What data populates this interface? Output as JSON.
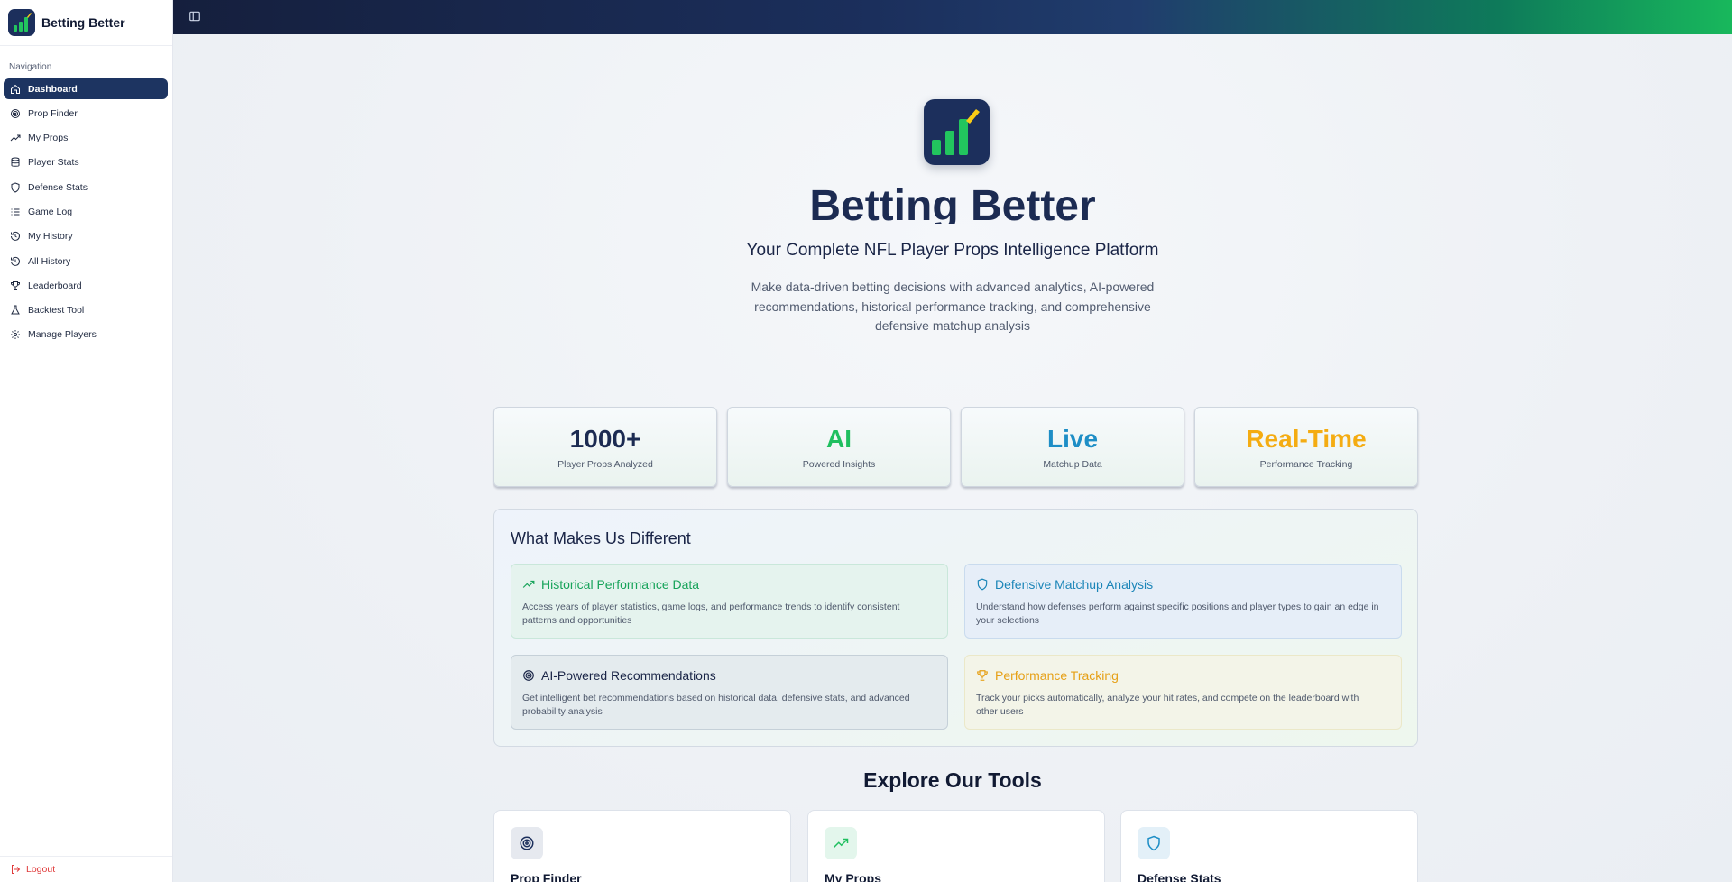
{
  "app": {
    "name": "Betting Better"
  },
  "sidebar": {
    "section_label": "Navigation",
    "items": [
      {
        "label": "Dashboard",
        "icon": "home-icon",
        "active": true
      },
      {
        "label": "Prop Finder",
        "icon": "target-icon"
      },
      {
        "label": "My Props",
        "icon": "trending-up-icon"
      },
      {
        "label": "Player Stats",
        "icon": "database-icon"
      },
      {
        "label": "Defense Stats",
        "icon": "shield-icon"
      },
      {
        "label": "Game Log",
        "icon": "list-icon"
      },
      {
        "label": "My History",
        "icon": "history-icon"
      },
      {
        "label": "All History",
        "icon": "history-icon"
      },
      {
        "label": "Leaderboard",
        "icon": "trophy-icon"
      },
      {
        "label": "Backtest Tool",
        "icon": "flask-icon"
      },
      {
        "label": "Manage Players",
        "icon": "gear-icon"
      }
    ],
    "logout_label": "Logout"
  },
  "hero": {
    "title": "Betting Better",
    "subtitle": "Your Complete NFL Player Props Intelligence Platform",
    "description": "Make data-driven betting decisions with advanced analytics, AI-powered recommendations, historical performance tracking, and comprehensive defensive matchup analysis"
  },
  "stats": [
    {
      "value": "1000+",
      "label": "Player Props Analyzed",
      "color": "#1c2b52"
    },
    {
      "value": "AI",
      "label": "Powered Insights",
      "color": "#1fbf5f"
    },
    {
      "value": "Live",
      "label": "Matchup Data",
      "color": "#1e8ec6"
    },
    {
      "value": "Real-Time",
      "label": "Performance Tracking",
      "color": "#f4ac12"
    }
  ],
  "different": {
    "title": "What Makes Us Different",
    "cards": [
      {
        "title": "Historical Performance Data",
        "icon": "trending-up-icon",
        "desc": "Access years of player statistics, game logs, and performance trends to identify consistent patterns and opportunities"
      },
      {
        "title": "Defensive Matchup Analysis",
        "icon": "shield-icon",
        "desc": "Understand how defenses perform against specific positions and player types to gain an edge in your selections"
      },
      {
        "title": "AI-Powered Recommendations",
        "icon": "target-icon",
        "desc": "Get intelligent bet recommendations based on historical data, defensive stats, and advanced probability analysis"
      },
      {
        "title": "Performance Tracking",
        "icon": "trophy-icon",
        "desc": "Track your picks automatically, analyze your hit rates, and compete on the leaderboard with other users"
      }
    ]
  },
  "tools": {
    "title": "Explore Our Tools",
    "items": [
      {
        "name": "Prop Finder",
        "icon": "target-icon"
      },
      {
        "name": "My Props",
        "icon": "trending-up-icon"
      },
      {
        "name": "Defense Stats",
        "icon": "shield-icon"
      }
    ]
  },
  "colors": {
    "navy": "#1c2f5c",
    "green": "#1fbf5f",
    "blue": "#1e8ec6",
    "amber": "#f4ac12",
    "danger": "#e03b3b"
  }
}
